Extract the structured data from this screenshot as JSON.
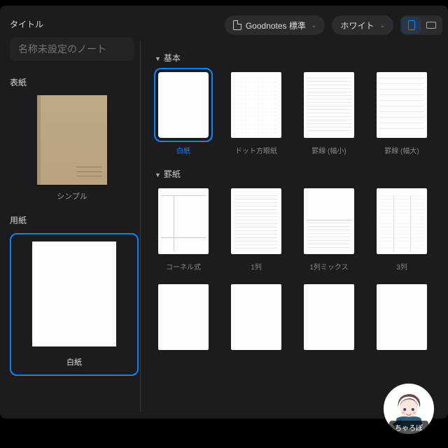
{
  "sidebar": {
    "title_label": "タイトル",
    "title_placeholder": "名称未設定のノート",
    "cover_label": "表紙",
    "cover_name": "シンプル",
    "paper_label": "用紙",
    "paper_name": "白紙"
  },
  "toolbar": {
    "size_preset": "Goodnotes 標準",
    "color": "ホワイト"
  },
  "sections": [
    {
      "title": "基本",
      "items": [
        {
          "label": "白紙",
          "style": "blank",
          "selected": true
        },
        {
          "label": "ドット方眼紙",
          "style": "dots"
        },
        {
          "label": "罫線 (幅小)",
          "style": "lines-s"
        },
        {
          "label": "罫線 (幅大)",
          "style": "lines-l"
        }
      ]
    },
    {
      "title": "罫紙",
      "items": [
        {
          "label": "コーネル式",
          "style": "cornell"
        },
        {
          "label": "1列",
          "style": "col1"
        },
        {
          "label": "1列ミックス",
          "style": "halfblank"
        },
        {
          "label": "3列",
          "style": "col3"
        }
      ]
    }
  ],
  "avatar_name": "ちゃろぽ"
}
